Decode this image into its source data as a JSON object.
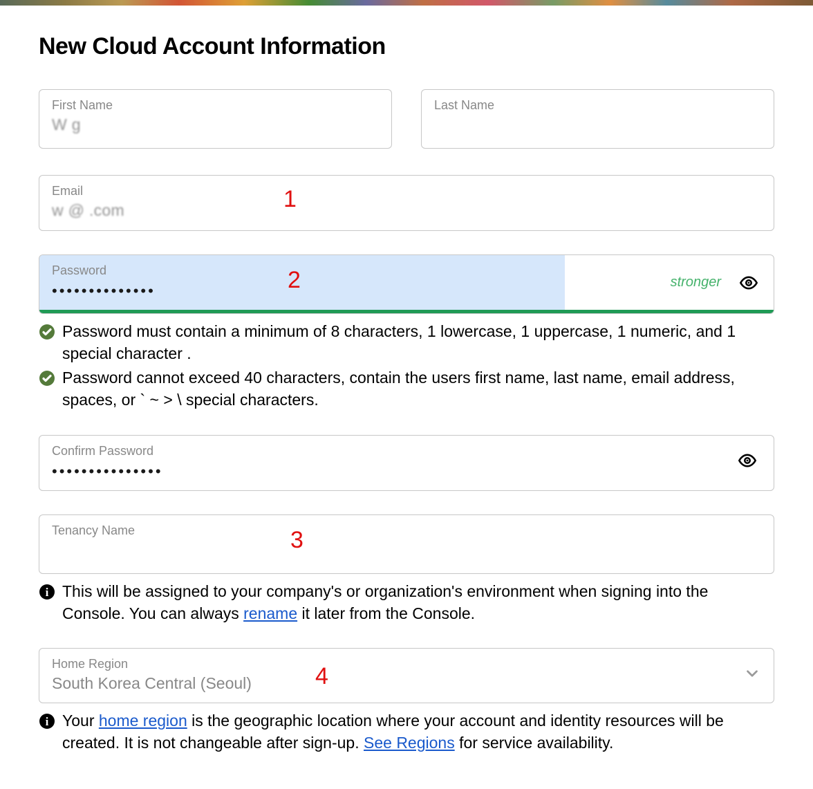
{
  "title": "New Cloud Account Information",
  "firstName": {
    "label": "First Name",
    "value": "W   g"
  },
  "lastName": {
    "label": "Last Name",
    "value": "   "
  },
  "email": {
    "label": "Email",
    "value": "w      @          .com"
  },
  "password": {
    "label": "Password",
    "mask": "••••••••••••••",
    "strength": "stronger"
  },
  "rules": {
    "r1": "Password must contain a minimum of 8 characters, 1 lowercase, 1 uppercase, 1 numeric, and 1 special character .",
    "r2": "Password cannot exceed 40 characters, contain the users first name, last name, email address, spaces, or ` ~ > \\ special characters."
  },
  "confirm": {
    "label": "Confirm Password",
    "mask": "•••••••••••••••"
  },
  "tenancy": {
    "label": "Tenancy Name",
    "value": "              "
  },
  "tenancyInfo": {
    "pre": "This will be assigned to your company's or organization's environment when signing into the Console. You can always ",
    "link": "rename",
    "post": " it later from the Console."
  },
  "region": {
    "label": "Home Region",
    "value": "South Korea Central (Seoul)"
  },
  "regionInfo": {
    "pre": "Your ",
    "link1": "home region",
    "mid": " is the geographic location where your account and identity resources will be created. It is not changeable after sign-up. ",
    "link2": "See Regions",
    "post": " for service availability."
  },
  "anno": {
    "a1": "1",
    "a2": "2",
    "a3": "3",
    "a4": "4"
  }
}
